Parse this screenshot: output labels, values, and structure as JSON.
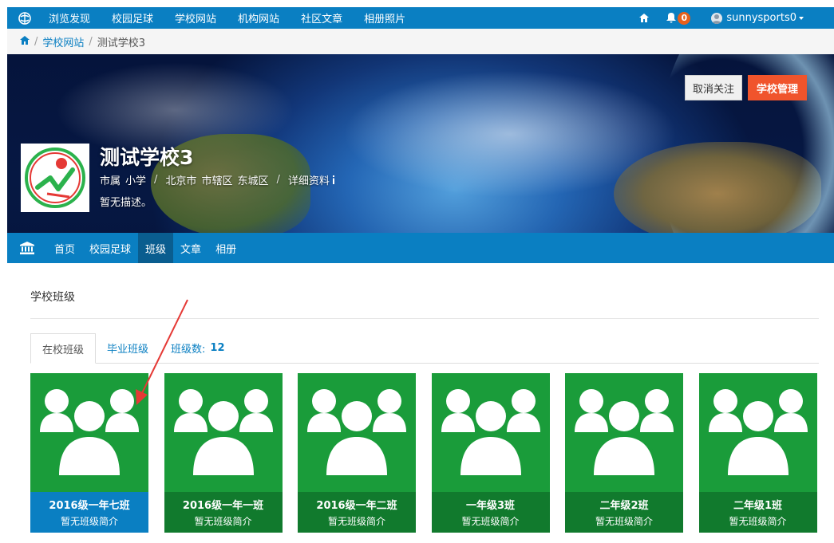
{
  "topnav": {
    "items": [
      "浏览发现",
      "校园足球",
      "学校网站",
      "机构网站",
      "社区文章",
      "相册照片"
    ],
    "notifications": "0",
    "username": "sunnysports0"
  },
  "breadcrumb": {
    "parent": "学校网站",
    "current": "测试学校3"
  },
  "school": {
    "name": "测试学校3",
    "type1": "市属",
    "type2": "小学",
    "city": "北京市",
    "district1": "市辖区",
    "district2": "东城区",
    "details_link": "详细资料",
    "description": "暂无描述。",
    "unfollow_label": "取消关注",
    "manage_label": "学校管理"
  },
  "schoolnav": {
    "items": [
      "首页",
      "校园足球",
      "班级",
      "文章",
      "相册"
    ],
    "active_index": 2
  },
  "classes": {
    "section_title": "学校班级",
    "tab_current": "在校班级",
    "tab_graduated": "毕业班级",
    "count_label": "班级数:",
    "count": "12",
    "cards": [
      {
        "name": "2016级一年七班",
        "desc": "暂无班级简介"
      },
      {
        "name": "2016级一年一班",
        "desc": "暂无班级简介"
      },
      {
        "name": "2016级一年二班",
        "desc": "暂无班级简介"
      },
      {
        "name": "一年级3班",
        "desc": "暂无班级简介"
      },
      {
        "name": "二年级2班",
        "desc": "暂无班级简介"
      },
      {
        "name": "二年级1班",
        "desc": "暂无班级简介"
      }
    ]
  },
  "colors": {
    "primary": "#0a7fc2",
    "accent": "#f0542c",
    "card_green": "#1a9c3a",
    "card_dark_green": "#117a2d"
  },
  "icons": [
    "site-logo-icon",
    "home-icon",
    "bell-icon",
    "user-avatar-icon",
    "bank-icon",
    "info-icon",
    "group-icon"
  ]
}
